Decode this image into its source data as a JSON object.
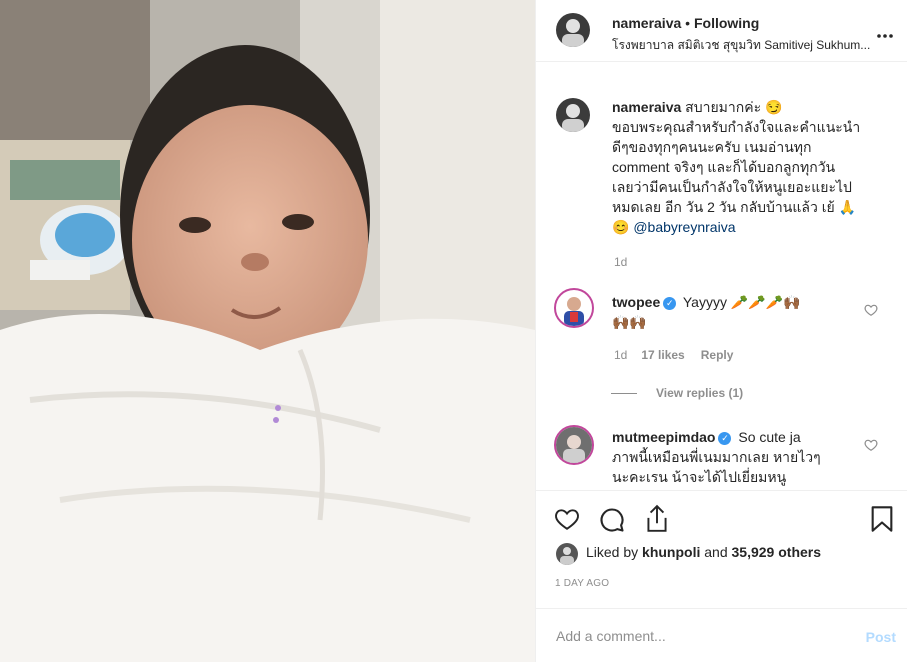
{
  "post": {
    "username": "nameraiva",
    "separator": "•",
    "follow_status": "Following",
    "location": "โรงพยาบาล สมิติเวช สุขุมวิท Samitivej Sukhum...",
    "more_icon": "more-horizontal-icon"
  },
  "caption": {
    "username": "nameraiva",
    "line1": "สบายมากค่ะ 😏",
    "line2": "ขอบพระคุณสำหรับกำลังใจและคำแนะนำ",
    "line3": "ดีๆของทุกๆคนนะครับ เนมอ่านทุก",
    "line4": "comment จริงๆ และก็ได้บอกลูกทุกวัน",
    "line5": "เลยว่ามีคนเป็นกำลังใจให้หนูเยอะแยะไป",
    "line6": "หมดเลย อีก วัน 2 วัน กลับบ้านแล้ว เย้ 🙏",
    "line7_emoji": "😊",
    "mention": "@babyreynraiva",
    "age": "1d"
  },
  "comments": [
    {
      "username": "twopee",
      "verified": true,
      "text_line1": "Yayyyy 🥕🥕🥕🙌🏾",
      "text_line2": "🙌🏾🙌🏾",
      "age": "1d",
      "likes": "17 likes",
      "reply_label": "Reply",
      "view_replies": "View replies (1)"
    },
    {
      "username": "mutmeepimdao",
      "verified": true,
      "text_line1": "So cute ja",
      "text_line2": "ภาพนี้เหมือนพี่เนมมากเลย หายไวๆ",
      "text_line3": "นะคะเรน น้าจะได้ไปเยี่ยมหนู"
    }
  ],
  "actions": {
    "like_icon": "heart-icon",
    "comment_icon": "comment-icon",
    "share_icon": "share-icon",
    "save_icon": "bookmark-icon"
  },
  "likes": {
    "prefix": "Liked by",
    "user": "khunpoli",
    "middle": "and",
    "count": "35,929 others"
  },
  "date": "1 DAY AGO",
  "add_comment": {
    "placeholder": "Add a comment...",
    "post_label": "Post"
  },
  "colors": {
    "verified": "#3897f0",
    "post_disabled": "#b3dbff",
    "border": "#efefef",
    "muted": "#8e8e8e"
  }
}
